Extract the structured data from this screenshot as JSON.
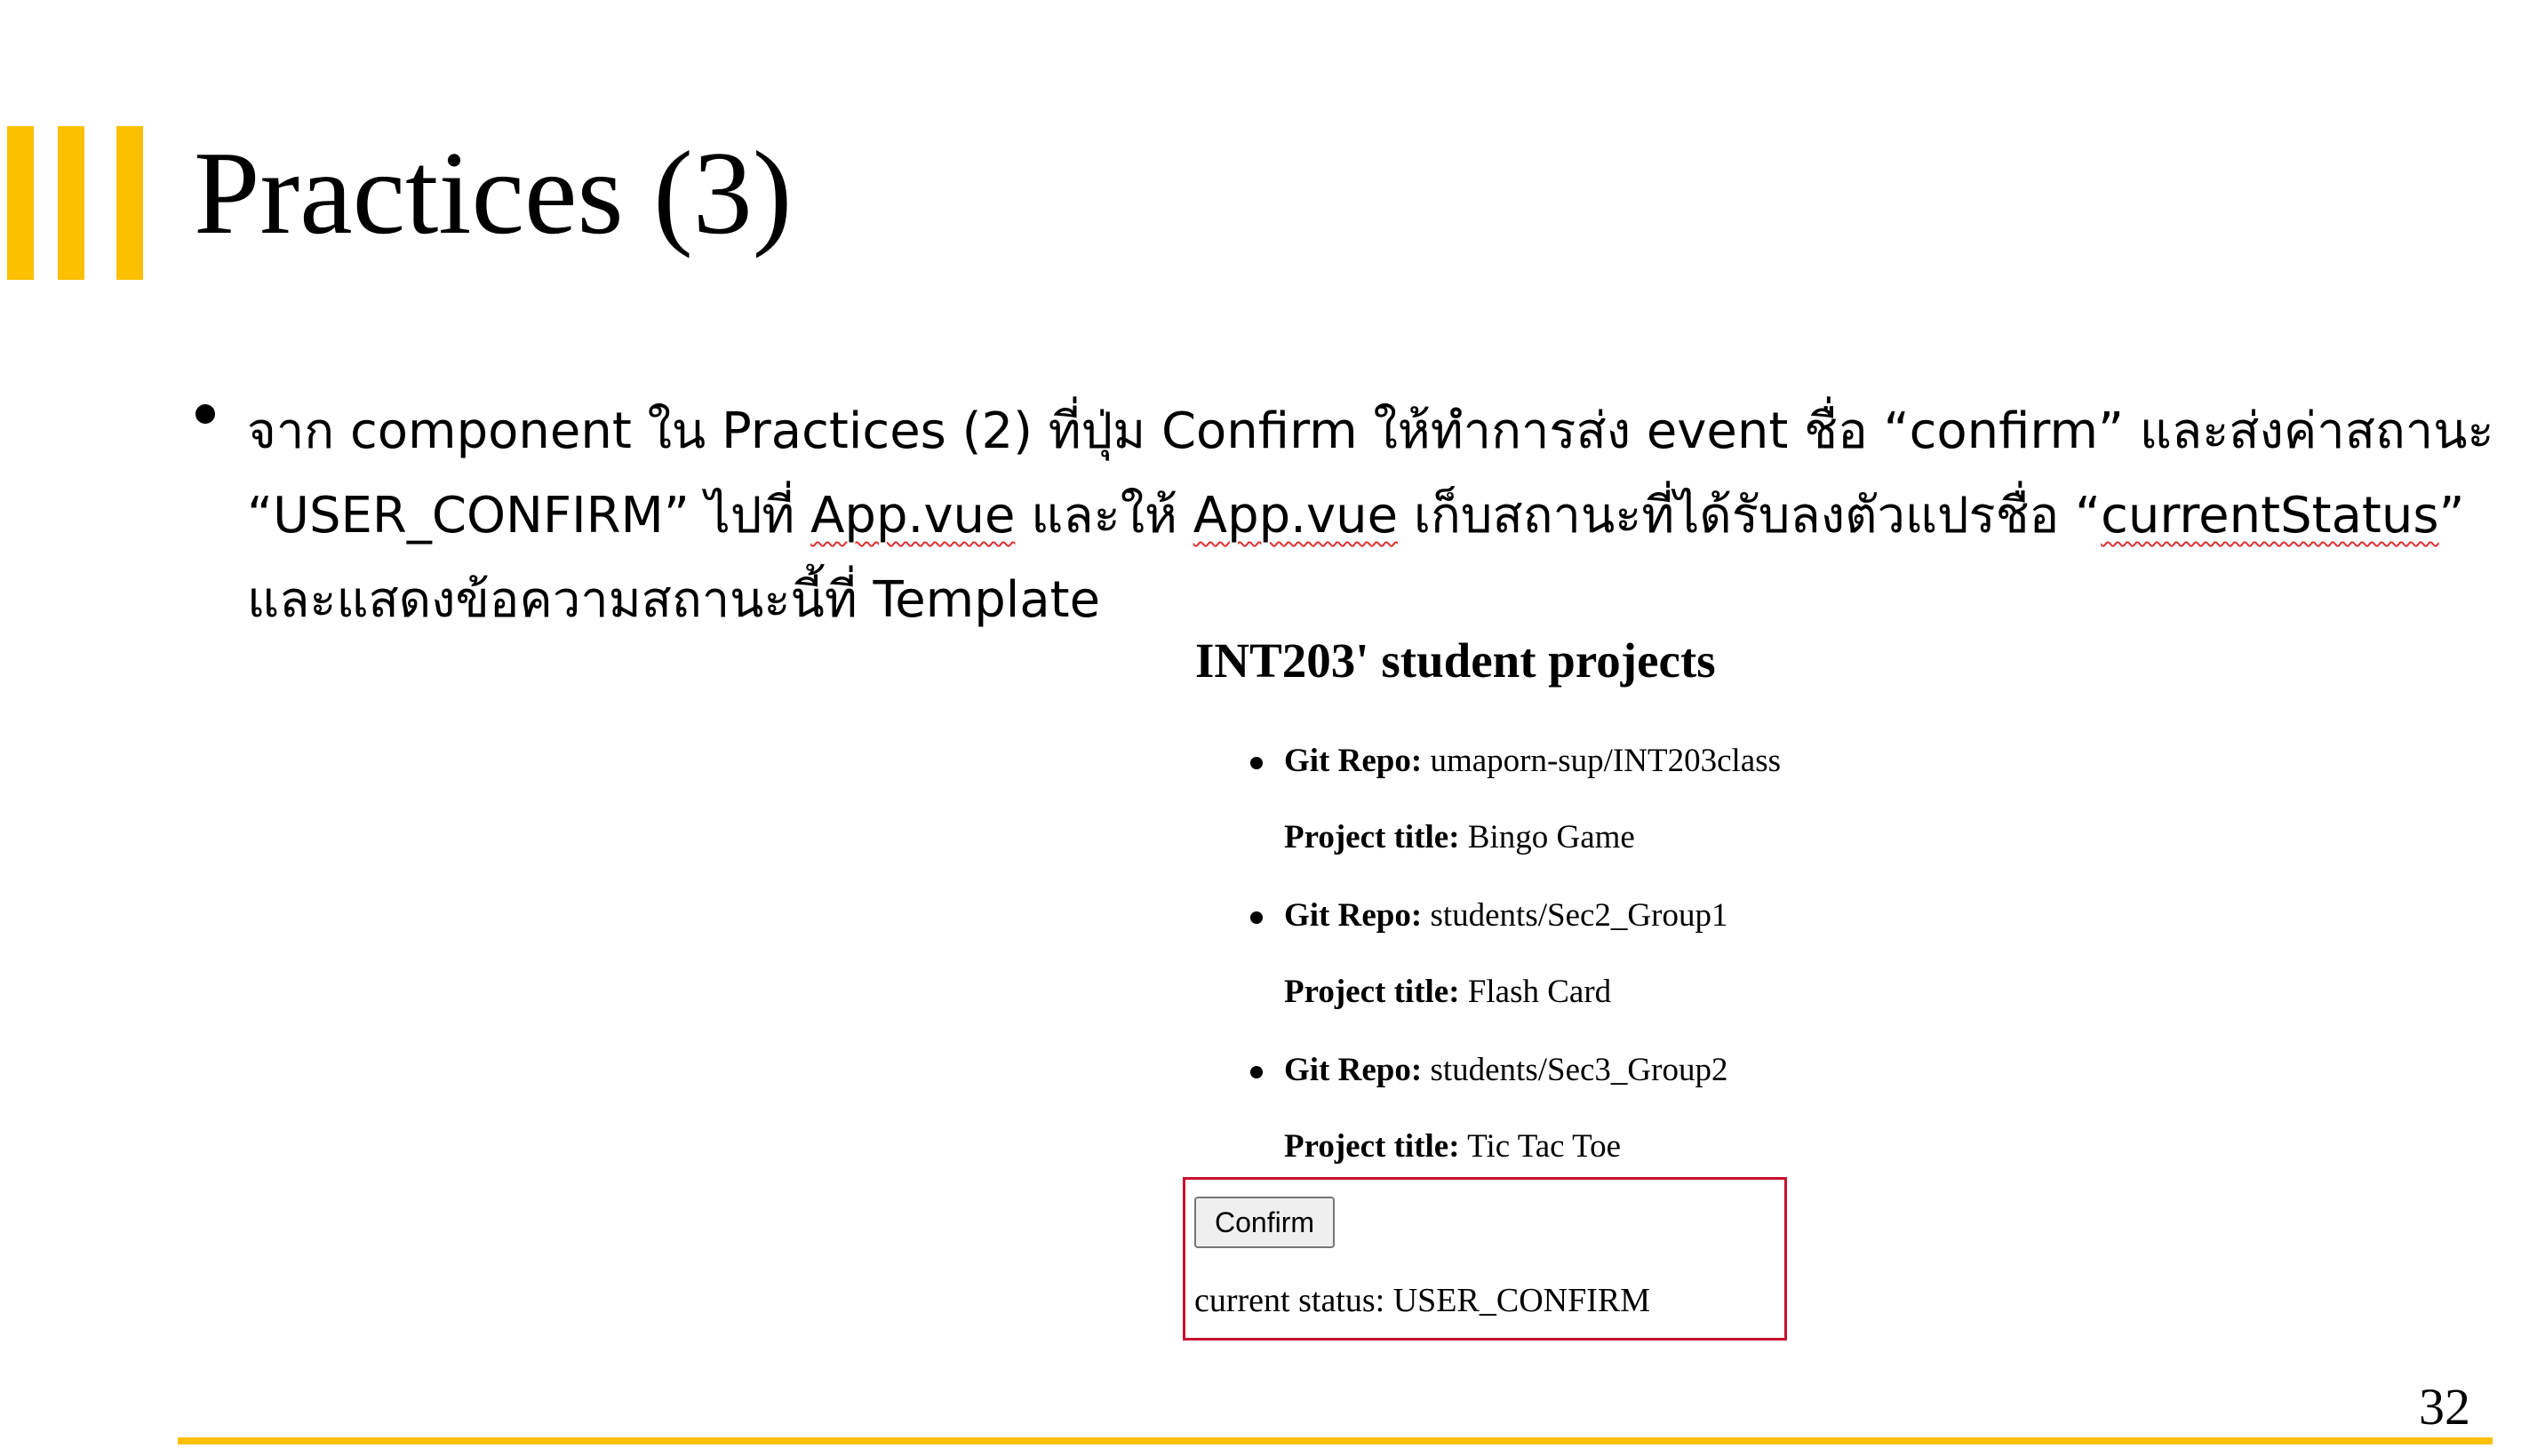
{
  "slide": {
    "title": "Practices (3)",
    "page_number": "32",
    "accent_color": "#fcc000",
    "body": {
      "line1": "จาก component ใน Practices (2) ที่ปุ่ม Confirm ให้ทำการส่ง event ชื่อ “confirm” และส่งค่าสถานะ",
      "line2_part1": "“USER_CONFIRM” ไปที่ ",
      "line2_appvue1": "App.vue",
      "line2_part2": " และให้ ",
      "line2_appvue2": "App.vue",
      "line2_part3": " เก็บสถานะที่ได้รับลงตัวแปรชื่อ “",
      "line2_var": "currentStatus",
      "line2_part4": "”",
      "line3": "และแสดงข้อความสถานะนี้ที่ Template"
    }
  },
  "app_preview": {
    "heading": "INT203' student projects",
    "repo_label": "Git Repo:",
    "title_label": "Project title:",
    "projects": [
      {
        "repo": "umaporn-sup/INT203class",
        "title": "Bingo Game"
      },
      {
        "repo": "students/Sec2_Group1",
        "title": "Flash Card"
      },
      {
        "repo": "students/Sec3_Group2",
        "title": "Tic Tac Toe"
      }
    ],
    "confirm_label": "Confirm",
    "status_label": "current status:",
    "status_value": "USER_CONFIRM",
    "highlight_color": "#c8102e"
  }
}
